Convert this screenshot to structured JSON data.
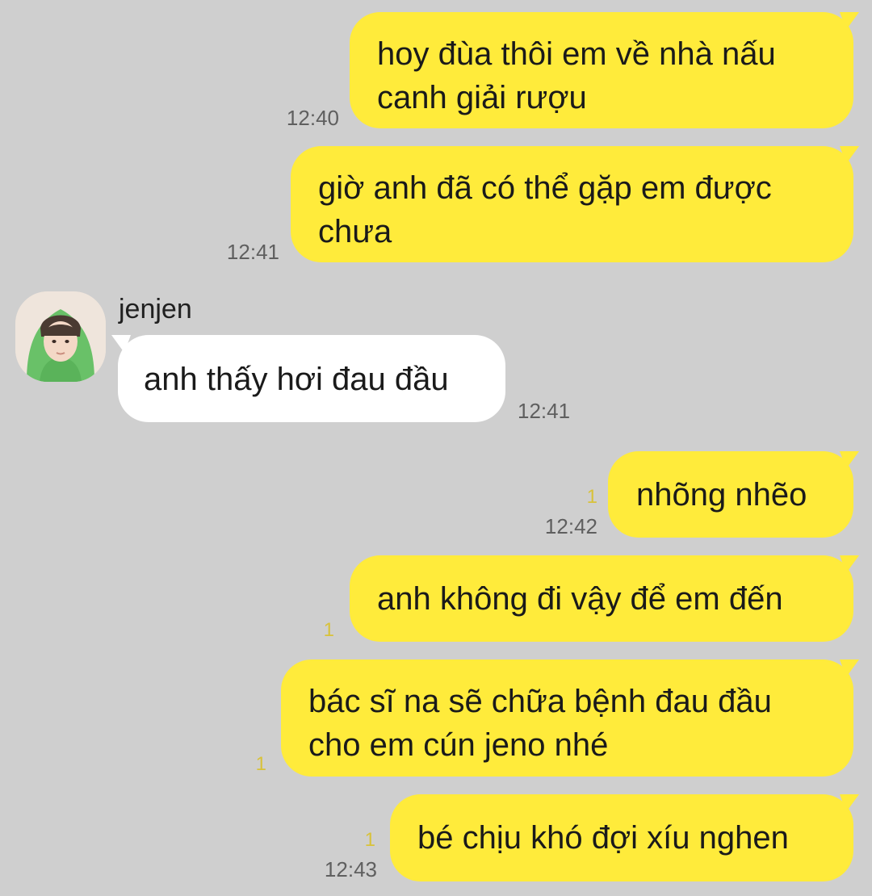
{
  "chat": {
    "colors": {
      "background": "#cfcfcf",
      "outgoing_bubble": "#ffeb3b",
      "incoming_bubble": "#ffffff",
      "timestamp": "#5f5f5f",
      "read_count": "#d8c23a"
    },
    "messages": [
      {
        "direction": "outgoing",
        "lines": [
          "hoy đùa thôi em về nhà nấu",
          "canh giải rượu"
        ],
        "time": "12:40",
        "read": ""
      },
      {
        "direction": "outgoing",
        "lines": [
          "giờ anh đã có thể gặp em được",
          "chưa"
        ],
        "time": "12:41",
        "read": ""
      },
      {
        "direction": "incoming",
        "sender": "jenjen",
        "avatar_icon": "profile-photo-icon",
        "lines": [
          "anh thấy hơi đau đầu"
        ],
        "time": "12:41",
        "read": ""
      },
      {
        "direction": "outgoing",
        "lines": [
          "nhõng nhẽo"
        ],
        "time": "12:42",
        "read": "1"
      },
      {
        "direction": "outgoing",
        "lines": [
          "anh không đi vậy để em đến"
        ],
        "time": "",
        "read": "1"
      },
      {
        "direction": "outgoing",
        "lines": [
          "bác sĩ na sẽ chữa bệnh đau đầu",
          "cho em cún jeno nhé"
        ],
        "time": "",
        "read": "1"
      },
      {
        "direction": "outgoing",
        "lines": [
          "bé chịu khó đợi xíu nghen"
        ],
        "time": "12:43",
        "read": "1"
      }
    ]
  }
}
